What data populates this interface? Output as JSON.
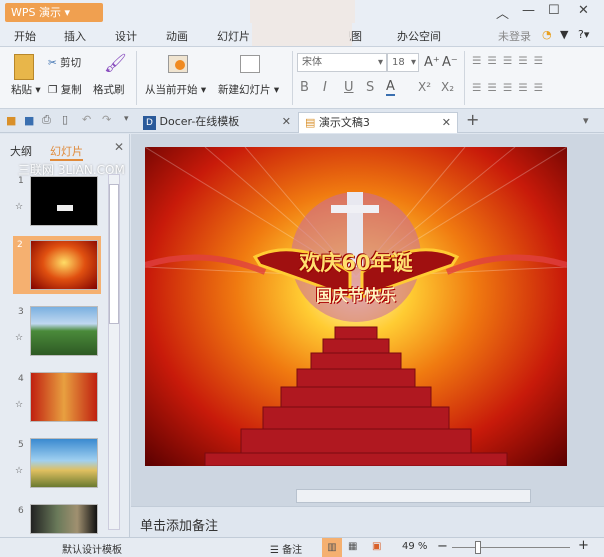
{
  "app": {
    "button": "WPS 演示",
    "login": "未登录"
  },
  "menu": [
    "开始",
    "插入",
    "设计",
    "动画",
    "幻灯片",
    "视图",
    "办公空间"
  ],
  "ribbon": {
    "paste": "粘贴",
    "cut": "剪切",
    "copy": "复制",
    "format_painter": "格式刷",
    "play_from_current": "从当前开始",
    "new_slide": "新建幻灯片",
    "font": "宋体",
    "font_size": "18"
  },
  "tabs": [
    {
      "label": "Docer-在线模板"
    },
    {
      "label": "演示文稿3"
    }
  ],
  "panel": {
    "outline_tab": "大纲",
    "slides_tab": "幻灯片",
    "watermark": "三联网 3LIAN.COM",
    "slide_numbers": [
      "1",
      "2",
      "3",
      "4",
      "5",
      "6"
    ]
  },
  "slide": {
    "line1": "欢庆60年诞",
    "line2": "国庆节快乐"
  },
  "notes": {
    "placeholder": "单击添加备注"
  },
  "status": {
    "template": "默认设计模板",
    "notes_label": "备注",
    "zoom": "49 %",
    "zoom_percent": 49
  }
}
